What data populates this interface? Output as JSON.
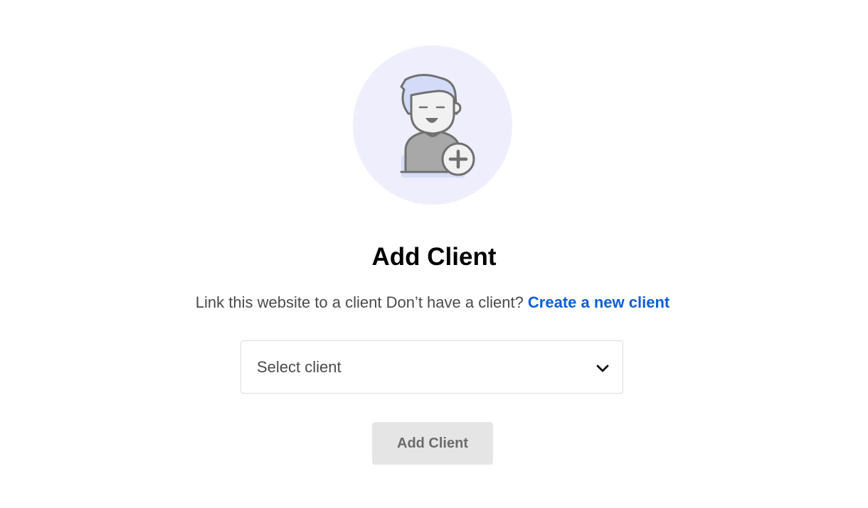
{
  "illustration": {
    "icon": "add-user-icon",
    "circle_color": "#efeefd"
  },
  "header": {
    "title": "Add Client"
  },
  "description": {
    "text": "Link this website to a client Don’t have a client? ",
    "link_label": "Create a new client",
    "link_color": "#0b5ed7"
  },
  "client_select": {
    "value": "Select client",
    "icon": "chevron-down-icon"
  },
  "actions": {
    "add_label": "Add Client"
  }
}
